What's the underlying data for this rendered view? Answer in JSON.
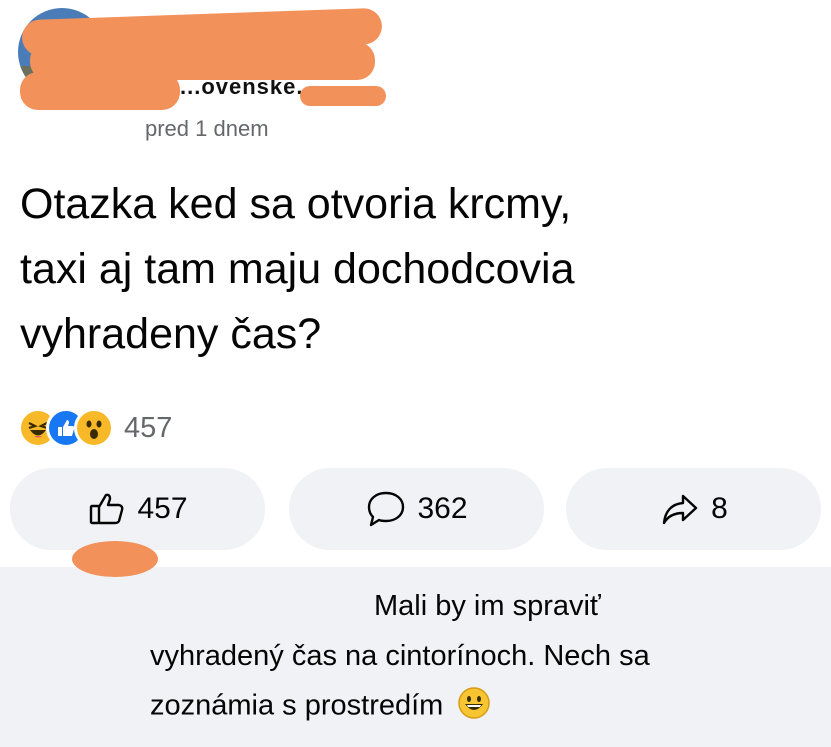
{
  "post": {
    "username": "...ovenske...",
    "timestamp": "pred 1 dnem",
    "text_line1": "Otazka ked sa otvoria krcmy,",
    "text_line2": "taxi aj tam maju dochodcovia",
    "text_line3": "vyhradeny čas?",
    "reaction_count": "457",
    "reaction_icons": [
      "haha-icon",
      "like-icon",
      "wow-icon"
    ]
  },
  "actions": {
    "like_count": "457",
    "comment_count": "362",
    "share_count": "8"
  },
  "comment": {
    "line1": "Mali by im spraviť",
    "line2": "vyhradený čas na cintorínoch. Nech sa",
    "line3": "zoznámia s prostredím",
    "emoji": "grinning-face-icon"
  },
  "colors": {
    "meta_text": "#65676b",
    "button_bg": "#f0f2f5",
    "like_blue": "#1877f2",
    "reaction_yellow": "#f7b928",
    "redaction": "#f2915a"
  }
}
